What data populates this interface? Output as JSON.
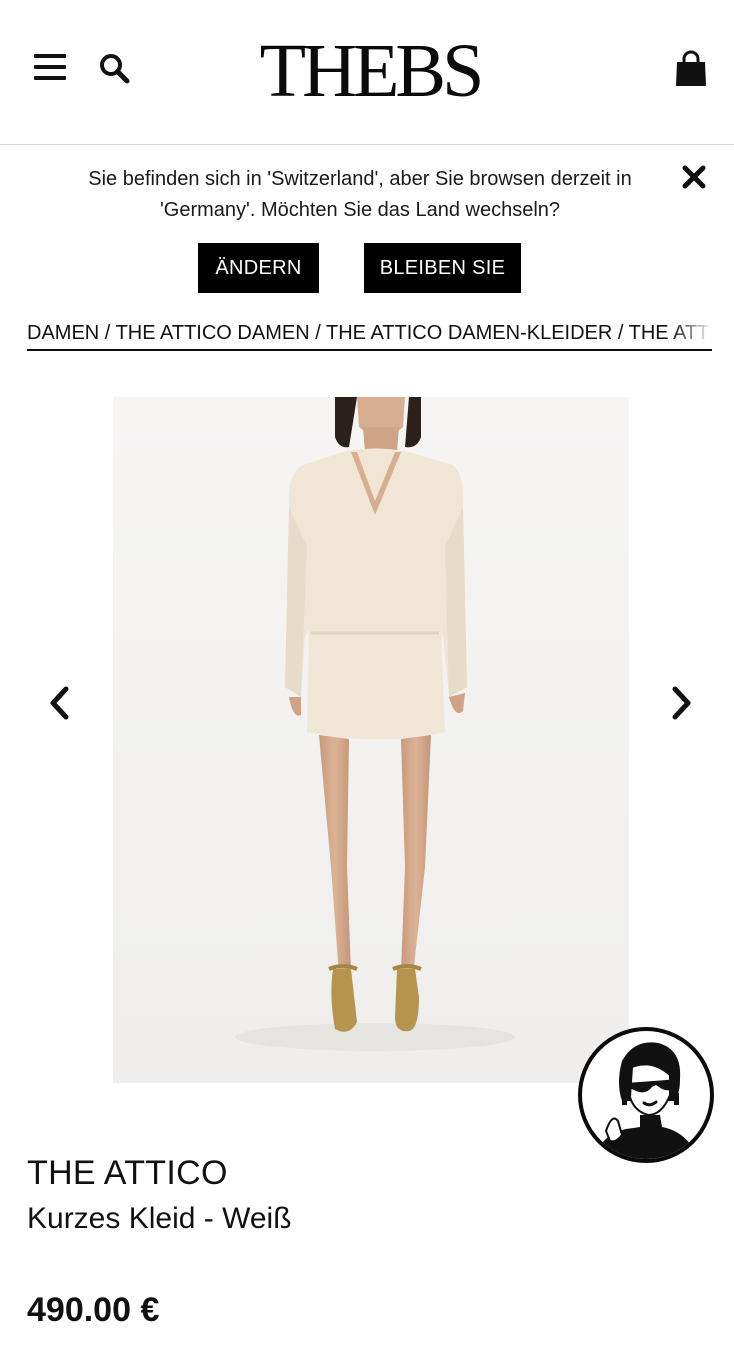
{
  "header": {
    "logo_text": "THEBS",
    "menu_icon": "hamburger-menu-icon",
    "search_icon": "search-icon",
    "cart_icon": "shopping-bag-icon"
  },
  "country_banner": {
    "message": "Sie befinden sich in 'Switzerland', aber Sie browsen derzeit in 'Germany'. Möchten Sie das Land wechseln?",
    "change_label": "ÄNDERN",
    "stay_label": "BLEIBEN SIE",
    "close_icon": "close-icon"
  },
  "breadcrumb": {
    "items": [
      "DAMEN",
      "THE ATTICO DAMEN",
      "THE ATTICO DAMEN-KLEIDER",
      "THE ATTICO"
    ],
    "separator": "/"
  },
  "gallery": {
    "prev_icon": "chevron-left-icon",
    "next_icon": "chevron-right-icon"
  },
  "product": {
    "brand": "THE ATTICO",
    "name": "Kurzes Kleid - Weiß",
    "price": "490.00 €"
  },
  "chat": {
    "avatar_icon": "chat-assistant-avatar-icon"
  },
  "colors": {
    "primary": "#000000",
    "background": "#ffffff",
    "image_background": "#f4f3f2",
    "dress": "#efe6d6"
  }
}
